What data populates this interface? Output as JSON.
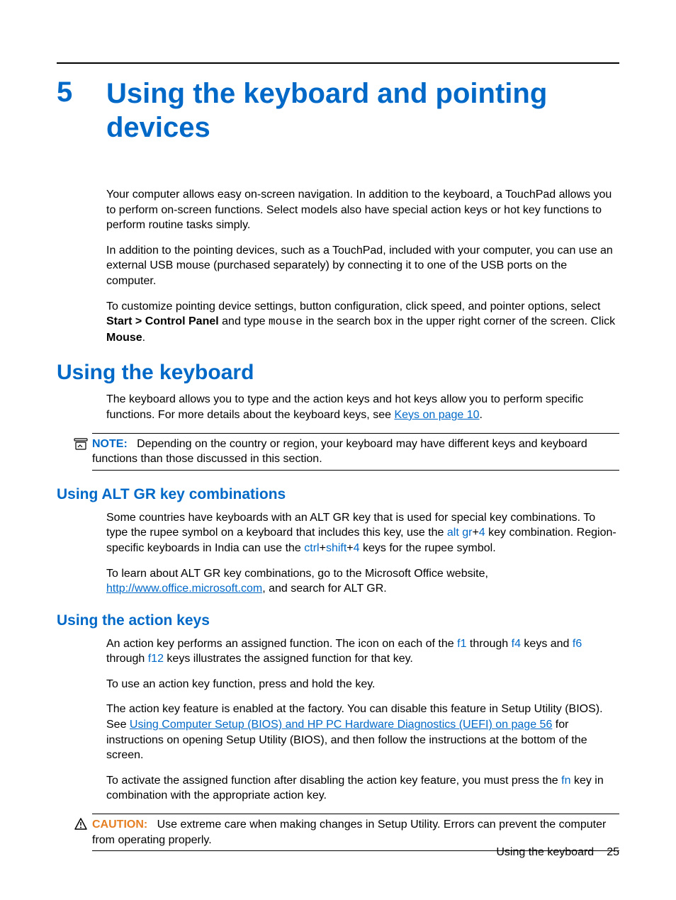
{
  "chapter": {
    "number": "5",
    "title": "Using the keyboard and pointing devices"
  },
  "intro": {
    "p1": "Your computer allows easy on-screen navigation. In addition to the keyboard, a TouchPad allows you to perform on-screen functions. Select models also have special action keys or hot key functions to perform routine tasks simply.",
    "p2": "In addition to the pointing devices, such as a TouchPad, included with your computer, you can use an external USB mouse (purchased separately) by connecting it to one of the USB ports on the computer.",
    "p3_a": "To customize pointing device settings, button configuration, click speed, and pointer options, select ",
    "p3_bold": "Start > Control Panel",
    "p3_b": " and type ",
    "p3_mono": "mouse",
    "p3_c": " in the search box in the upper right corner of the screen. Click ",
    "p3_bold2": "Mouse",
    "p3_d": "."
  },
  "section1": {
    "heading": "Using the keyboard",
    "p1_a": "The keyboard allows you to type and the action keys and hot keys allow you to perform specific functions. For more details about the keyboard keys, see ",
    "p1_link": "Keys on page 10",
    "p1_b": ".",
    "note_label": "NOTE:",
    "note_text": "Depending on the country or region, your keyboard may have different keys and keyboard functions than those discussed in this section."
  },
  "section2": {
    "heading": "Using ALT GR key combinations",
    "p1_a": "Some countries have keyboards with an ALT GR key that is used for special key combinations. To type the rupee symbol on a keyboard that includes this key, use the ",
    "k1": "alt gr",
    "plus1": "+",
    "k2": "4",
    "p1_b": " key combination. Region-specific keyboards in India can use the ",
    "k3": "ctrl",
    "plus2": "+",
    "k4": "shift",
    "plus3": "+",
    "k5": "4",
    "p1_c": " keys for the rupee symbol.",
    "p2_a": "To learn about ALT GR key combinations, go to the Microsoft Office website, ",
    "p2_link": "http://www.office.microsoft.com",
    "p2_b": ", and search for ALT GR."
  },
  "section3": {
    "heading": "Using the action keys",
    "p1_a": "An action key performs an assigned function. The icon on each of the ",
    "k1": "f1",
    "p1_b": " through ",
    "k2": "f4",
    "p1_c": " keys and ",
    "k3": "f6",
    "p1_d": " through ",
    "k4": "f12",
    "p1_e": " keys illustrates the assigned function for that key.",
    "p2": "To use an action key function, press and hold the key.",
    "p3_a": "The action key feature is enabled at the factory. You can disable this feature in Setup Utility (BIOS). See ",
    "p3_link": "Using Computer Setup (BIOS) and HP PC Hardware Diagnostics (UEFI) on page 56",
    "p3_b": " for instructions on opening Setup Utility (BIOS), and then follow the instructions at the bottom of the screen.",
    "p4_a": "To activate the assigned function after disabling the action key feature, you must press the ",
    "k5": "fn",
    "p4_b": " key in combination with the appropriate action key.",
    "caution_label": "CAUTION:",
    "caution_text": "Use extreme care when making changes in Setup Utility. Errors can prevent the computer from operating properly."
  },
  "footer": {
    "text": "Using the keyboard",
    "page": "25"
  }
}
